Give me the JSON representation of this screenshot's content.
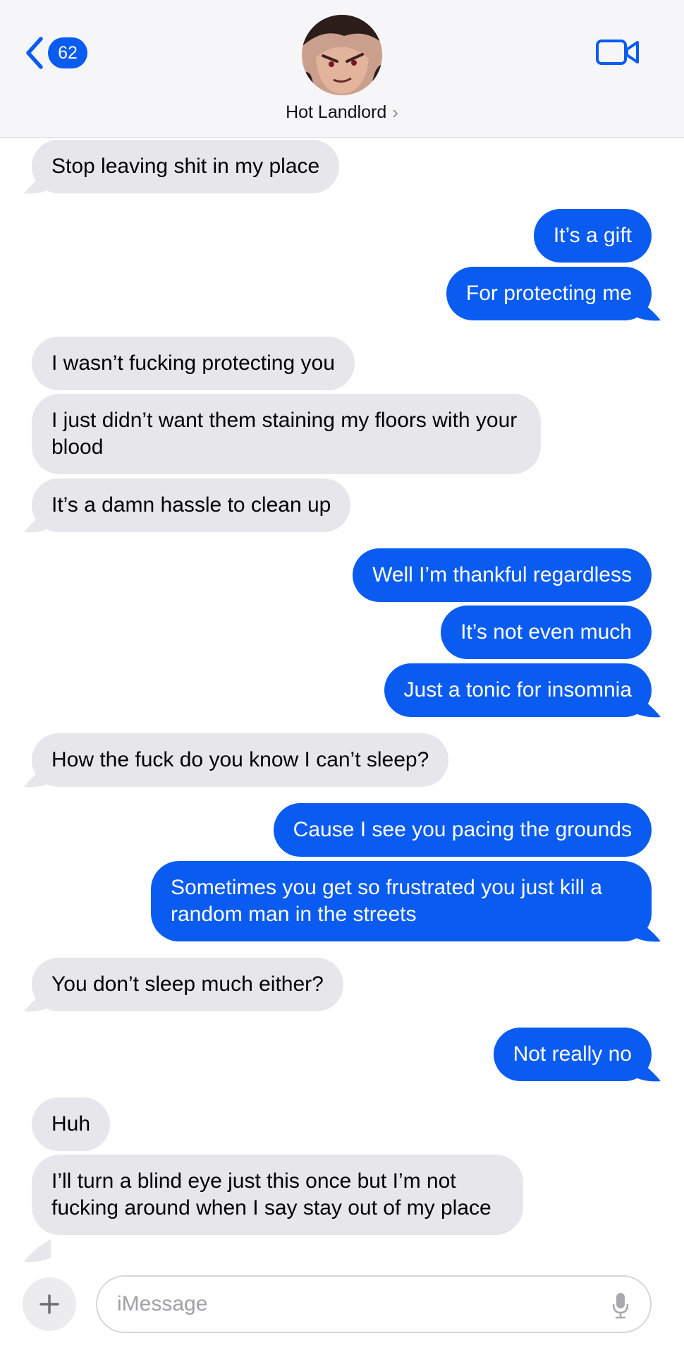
{
  "header": {
    "back_count": "62",
    "contact_name": "Hot Landlord",
    "contact_chevron": "›"
  },
  "messages": [
    {
      "side": "recv",
      "text": "Stop leaving shit in my place",
      "tail": true
    },
    {
      "side": "sent",
      "text": "It’s a gift",
      "tail": false
    },
    {
      "side": "sent",
      "text": "For protecting me",
      "tail": true
    },
    {
      "side": "recv",
      "text": "I wasn’t fucking protecting you",
      "tail": false
    },
    {
      "side": "recv",
      "text": "I just didn’t want them staining my floors with your blood",
      "tail": false
    },
    {
      "side": "recv",
      "text": "It’s a damn hassle to clean up",
      "tail": true
    },
    {
      "side": "sent",
      "text": "Well I’m thankful regardless",
      "tail": false
    },
    {
      "side": "sent",
      "text": "It’s not even much",
      "tail": false
    },
    {
      "side": "sent",
      "text": "Just a tonic for insomnia",
      "tail": true
    },
    {
      "side": "recv",
      "text": "How the fuck do you know I can’t sleep?",
      "tail": true
    },
    {
      "side": "sent",
      "text": "Cause I see you pacing the grounds",
      "tail": false
    },
    {
      "side": "sent",
      "text": "Sometimes you get so frustrated you just kill a random man in the streets",
      "tail": true
    },
    {
      "side": "recv",
      "text": "You don’t sleep much either?",
      "tail": true
    },
    {
      "side": "sent",
      "text": "Not really no",
      "tail": true
    },
    {
      "side": "recv",
      "text": "Huh",
      "tail": false
    },
    {
      "side": "recv",
      "text": "I’ll turn a blind eye just this once but I’m not fucking around when I say stay out of my place",
      "tail": true
    }
  ],
  "input": {
    "placeholder": "iMessage"
  },
  "colors": {
    "sent_bubble": "#0a5bf0",
    "recv_bubble": "#e6e6eb",
    "accent": "#0a5bf0"
  },
  "icons": {
    "back": "chevron-left-icon",
    "video": "video-camera-icon",
    "plus": "plus-icon",
    "mic": "microphone-icon"
  }
}
